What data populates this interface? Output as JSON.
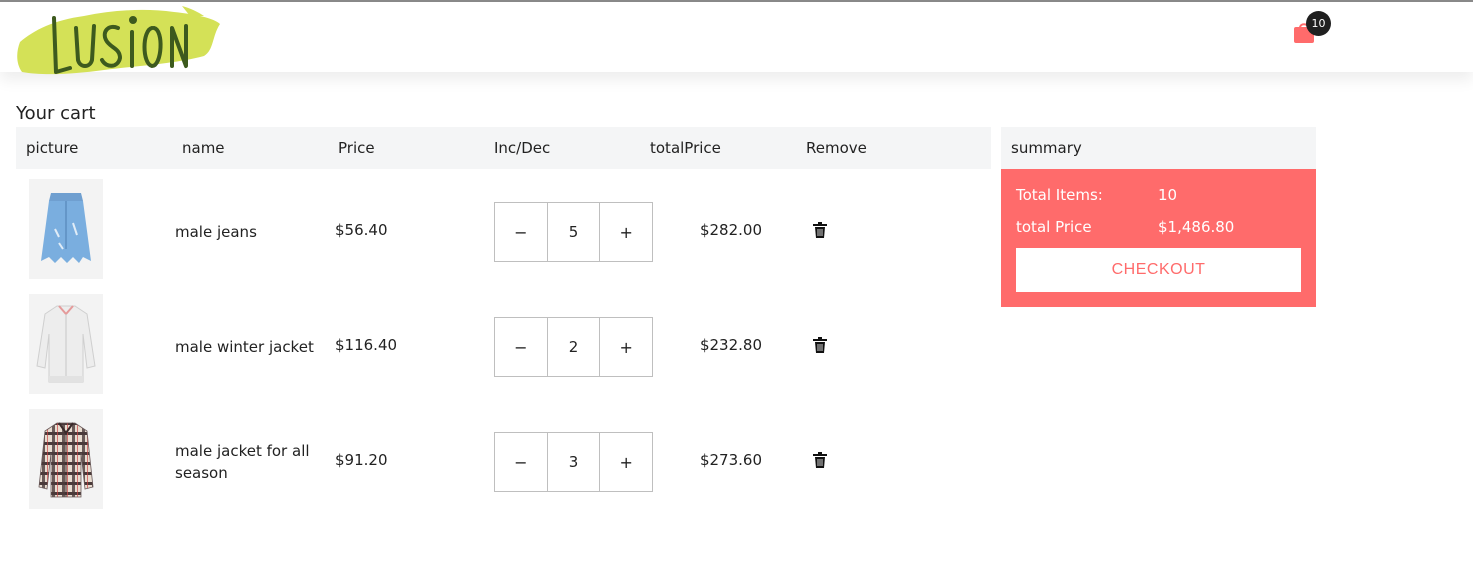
{
  "brand": {
    "logo_text": "LUSION",
    "accent": "#ff6b6b",
    "logo_bg": "#d4e157",
    "logo_ink": "#3d5a1e"
  },
  "nav": {
    "cart_icon": "shopping-bag-icon",
    "cart_count": "10"
  },
  "cart": {
    "title": "Your cart",
    "headers": {
      "picture": "picture",
      "name": "name",
      "price": "Price",
      "incdec": "Inc/Dec",
      "total": "totalPrice",
      "remove": "Remove"
    },
    "items": [
      {
        "name": "male jeans",
        "price": "$56.40",
        "qty": "5",
        "total": "$282.00",
        "image": "denim-skirt-image"
      },
      {
        "name": "male winter jacket",
        "price": "$116.40",
        "qty": "2",
        "total": "$232.80",
        "image": "white-bomber-jacket-image"
      },
      {
        "name": "male jacket for all season",
        "price": "$91.20",
        "qty": "3",
        "total": "$273.60",
        "image": "plaid-shirt-jacket-image"
      }
    ],
    "stepper": {
      "dec": "−",
      "inc": "+"
    }
  },
  "summary": {
    "title": "summary",
    "items_label": "Total Items:",
    "items_value": "10",
    "price_label": "total Price",
    "price_value": "$1,486.80",
    "checkout_label": "CHECKOUT"
  }
}
